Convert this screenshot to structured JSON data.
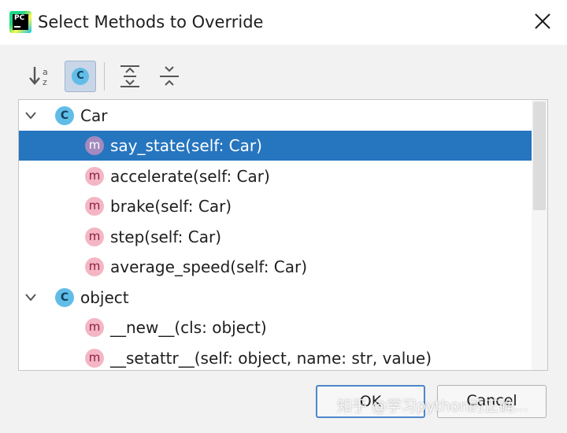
{
  "window": {
    "title": "Select Methods to Override",
    "logo_text": "PC",
    "close_label": "close"
  },
  "toolbar": {
    "sort_alpha_icon": "sort-alphabetically-icon",
    "show_classes_label": "C",
    "expand_all_icon": "expand-all-icon",
    "collapse_all_icon": "collapse-all-icon"
  },
  "tree": {
    "groups": [
      {
        "class_icon": "C",
        "name": "Car",
        "methods": [
          {
            "icon": "m",
            "label": "say_state(self: Car)",
            "selected": true
          },
          {
            "icon": "m",
            "label": "accelerate(self: Car)",
            "selected": false
          },
          {
            "icon": "m",
            "label": "brake(self: Car)",
            "selected": false
          },
          {
            "icon": "m",
            "label": "step(self: Car)",
            "selected": false
          },
          {
            "icon": "m",
            "label": "average_speed(self: Car)",
            "selected": false
          }
        ]
      },
      {
        "class_icon": "C",
        "name": "object",
        "methods": [
          {
            "icon": "m",
            "label": "__new__(cls: object)",
            "selected": false
          },
          {
            "icon": "m",
            "label": "__setattr__(self: object, name: str, value)",
            "selected": false
          }
        ]
      }
    ]
  },
  "buttons": {
    "ok": "OK",
    "cancel": "Cancel"
  },
  "watermark": "知乎 @学习python的正确...",
  "colors": {
    "selection": "#2675bf",
    "class_icon": "#61bde8",
    "method_icon": "#f4b6c4"
  }
}
